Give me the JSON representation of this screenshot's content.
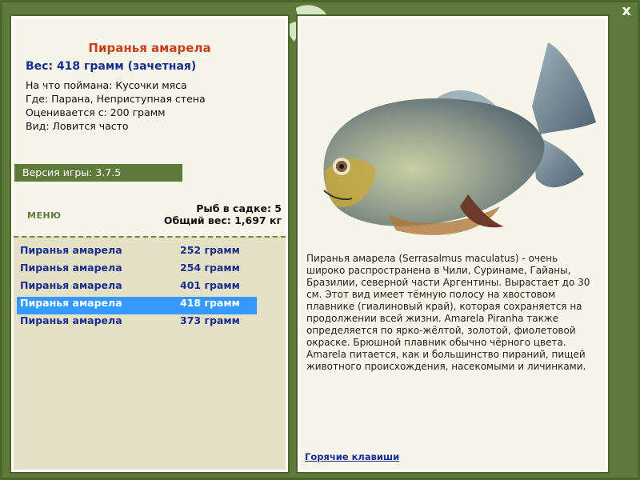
{
  "window": {
    "close_label": "x"
  },
  "fish": {
    "title": "Пиранья амарела",
    "weight_line": "Вес: 418 грамм (зачетная)",
    "caught_with": "На что поймана: Кусочки мяса",
    "location": "Где: Парана, Неприступная стена",
    "valued_from": "Оценивается с: 200 грамм",
    "frequency": "Вид: Ловится часто"
  },
  "version": "Версия игры: 3.7.5",
  "menu_label": "МЕНЮ",
  "totals": {
    "fish_in_cage": "Рыб в садке: 5",
    "total_weight": "Общий вес: 1,697 кг"
  },
  "catches": [
    {
      "name": "Пиранья амарела",
      "weight": "252 грамм"
    },
    {
      "name": "Пиранья амарела",
      "weight": "254 грамм"
    },
    {
      "name": "Пиранья амарела",
      "weight": "401 грамм"
    },
    {
      "name": "Пиранья амарела",
      "weight": "418 грамм",
      "selected": true
    },
    {
      "name": "Пиранья амарела",
      "weight": "373 грамм"
    }
  ],
  "description": "Пиранья амарела (Serrasalmus maculatus) - очень широко распространена в Чили, Суринаме, Гайаны, Бразилии, северной части Аргентины. Вырастает до 30 см. Этот вид имеет тёмную полосу на хвостовом плавнике (гиалиновый край), которая сохраняется на продолжении всей жизни. Amarela Piranha также определяется по ярко-жёлтой, золотой, фиолетовой окраске. Брюшной плавник обычно чёрного цвета. Amarela питается, как и большинство пираний, пищей животного происхождения, насекомыми и личинками.",
  "hotkeys_label": "Горячие клавиши",
  "colors": {
    "frame": "#5f7a3a",
    "title": "#c6401a",
    "link": "#1a2f8c",
    "selection": "#3399ff"
  },
  "icons": {
    "close": "close-icon",
    "decoration": "leaf-ornament-icon",
    "fish_picture": "piranha-image"
  }
}
